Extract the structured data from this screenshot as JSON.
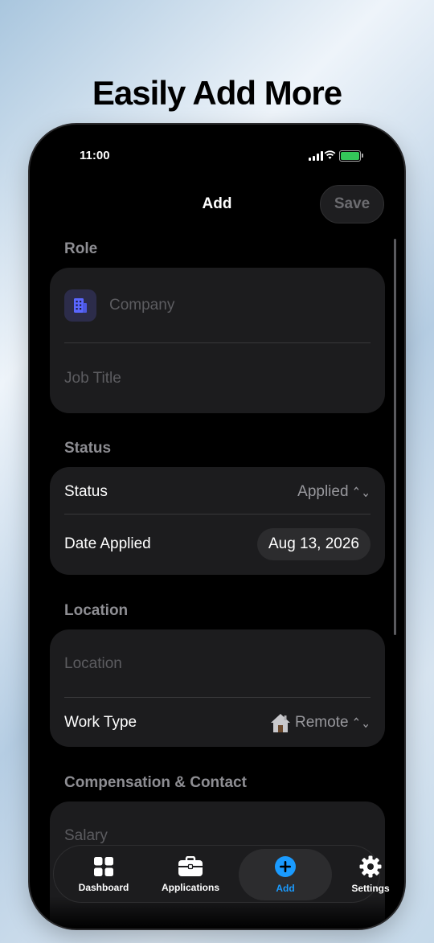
{
  "marketing": {
    "headline": "Easily Add More"
  },
  "status_bar": {
    "time": "11:00"
  },
  "nav": {
    "title": "Add",
    "save_label": "Save"
  },
  "sections": {
    "role": {
      "title": "Role",
      "company_placeholder": "Company",
      "job_title_placeholder": "Job Title"
    },
    "status": {
      "title": "Status",
      "status_label": "Status",
      "status_value": "Applied",
      "date_label": "Date Applied",
      "date_value": "Aug 13, 2026"
    },
    "location": {
      "title": "Location",
      "location_placeholder": "Location",
      "work_type_label": "Work Type",
      "work_type_value": "Remote"
    },
    "compensation": {
      "title": "Compensation & Contact",
      "salary_placeholder": "Salary"
    }
  },
  "tabbar": {
    "items": [
      {
        "label": "Dashboard",
        "icon": "grid-icon"
      },
      {
        "label": "Applications",
        "icon": "briefcase-icon"
      },
      {
        "label": "Add",
        "icon": "plus-circle-icon"
      },
      {
        "label": "Settings",
        "icon": "gear-icon"
      }
    ]
  },
  "colors": {
    "accent": "#1a9bff",
    "battery": "#34c759",
    "card": "#1c1c1e"
  }
}
